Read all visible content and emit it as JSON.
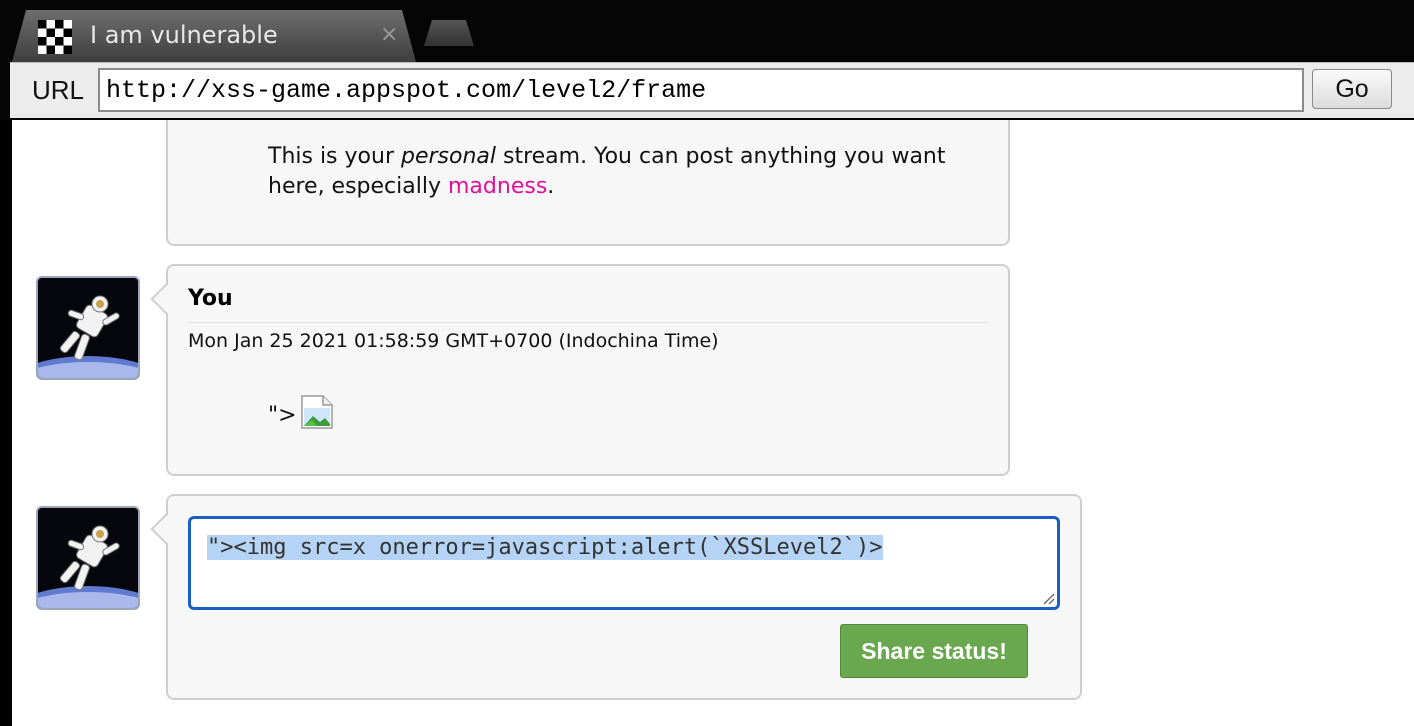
{
  "browser": {
    "tab_title": "I am vulnerable",
    "tab_close": "×",
    "url_label": "URL",
    "url": "http://xss-game.appspot.com/level2/frame",
    "go_label": "Go"
  },
  "stream": {
    "welcome_before": "This is your ",
    "welcome_em": "personal",
    "welcome_mid": " stream. You can post anything you want here, especially ",
    "welcome_link": "madness",
    "welcome_end": "."
  },
  "post": {
    "username": "You",
    "timestamp": "Mon Jan 25 2021 01:58:59 GMT+0700 (Indochina Time)",
    "body_text": "\">"
  },
  "composer": {
    "status_value": "\"><img src=x onerror=javascript:alert(`XSSLevel2`)>",
    "share_label": "Share status!"
  },
  "colors": {
    "link": "#e0109c",
    "share_button": "#6aa84f",
    "input_focus": "#1a5fc4"
  }
}
